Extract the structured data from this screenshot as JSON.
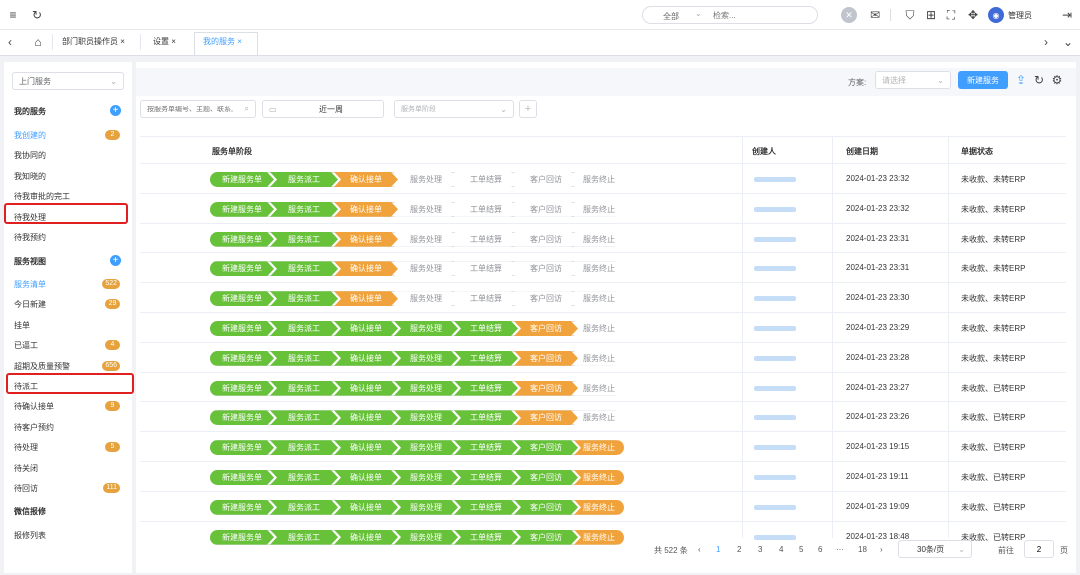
{
  "topbar": {
    "filter_value": "全部",
    "search_placeholder": "检索...",
    "user_label": "管理员",
    "colors": {
      "accent": "#409eff",
      "avatar": "#3f6ad8"
    }
  },
  "tabs": [
    {
      "label": "部门职员操作员 ×",
      "active": false
    },
    {
      "label": "设置 ×",
      "active": false
    },
    {
      "label": "我的服务 ×",
      "active": true
    }
  ],
  "sidebar": {
    "dropdown_value": "上门服务",
    "section1_title": "我的服务",
    "section1_items": [
      {
        "label": "我创建的",
        "badge": "2",
        "active": true
      },
      {
        "label": "我协同的",
        "badge": ""
      },
      {
        "label": "我知晓的",
        "badge": ""
      },
      {
        "label": "待我审批的完工",
        "badge": ""
      },
      {
        "label": "待我处理",
        "badge": "",
        "highlighted": true
      },
      {
        "label": "待我预约",
        "badge": ""
      }
    ],
    "section2_title": "服务视图",
    "section2_items": [
      {
        "label": "服务清单",
        "badge": "522",
        "active": true
      },
      {
        "label": "今日新建",
        "badge": "29"
      },
      {
        "label": "挂单",
        "badge": ""
      },
      {
        "label": "已逼工",
        "badge": "4"
      },
      {
        "label": "超期及质量预警",
        "badge": "656"
      },
      {
        "label": "待派工",
        "badge": "",
        "highlighted": true
      },
      {
        "label": "待确认接单",
        "badge": "9"
      },
      {
        "label": "待客户预约",
        "badge": ""
      },
      {
        "label": "待处理",
        "badge": "5"
      },
      {
        "label": "待关闭",
        "badge": ""
      },
      {
        "label": "待回访",
        "badge": "111"
      }
    ],
    "section3_title": "微信报修",
    "section3_items": [
      {
        "label": "报修列表",
        "badge": ""
      }
    ]
  },
  "toolbar": {
    "scheme_label": "方案:",
    "scheme_placeholder": "请选择",
    "new_button": "新建服务",
    "search_placeholder": "按服务单编号、主题、联系,",
    "date_value": "近一周",
    "stage_placeholder": "服务单阶段"
  },
  "table": {
    "headers": [
      "服务单阶段",
      "创建人",
      "创建日期",
      "单据状态"
    ],
    "stage_names": [
      "新建服务单",
      "服务派工",
      "确认接单",
      "服务处理",
      "工单结算",
      "客户回访",
      "服务终止"
    ],
    "rows": [
      {
        "current": 2,
        "date": "2024-01-23 23:32",
        "status": "未收款、未转ERP"
      },
      {
        "current": 2,
        "date": "2024-01-23 23:32",
        "status": "未收款、未转ERP"
      },
      {
        "current": 2,
        "date": "2024-01-23 23:31",
        "status": "未收款、未转ERP"
      },
      {
        "current": 2,
        "date": "2024-01-23 23:31",
        "status": "未收款、未转ERP"
      },
      {
        "current": 2,
        "date": "2024-01-23 23:30",
        "status": "未收款、未转ERP"
      },
      {
        "current": 5,
        "date": "2024-01-23 23:29",
        "status": "未收款、未转ERP"
      },
      {
        "current": 5,
        "date": "2024-01-23 23:28",
        "status": "未收款、未转ERP"
      },
      {
        "current": 5,
        "date": "2024-01-23 23:27",
        "status": "未收款、已转ERP"
      },
      {
        "current": 5,
        "date": "2024-01-23 23:26",
        "status": "未收款、已转ERP"
      },
      {
        "current": 6,
        "date": "2024-01-23 19:15",
        "status": "未收款、已转ERP"
      },
      {
        "current": 6,
        "date": "2024-01-23 19:11",
        "status": "未收款、已转ERP"
      },
      {
        "current": 6,
        "date": "2024-01-23 19:09",
        "status": "未收款、已转ERP"
      },
      {
        "current": 6,
        "date": "2024-01-23 18:48",
        "status": "未收款、已转ERP"
      }
    ]
  },
  "pagination": {
    "total": "共 522 条",
    "pages": [
      "1",
      "2",
      "3",
      "4",
      "5",
      "6",
      "···",
      "18"
    ],
    "page_size": "30条/页",
    "goto_label": "前往",
    "goto_value": "2",
    "page_suffix": "页"
  }
}
